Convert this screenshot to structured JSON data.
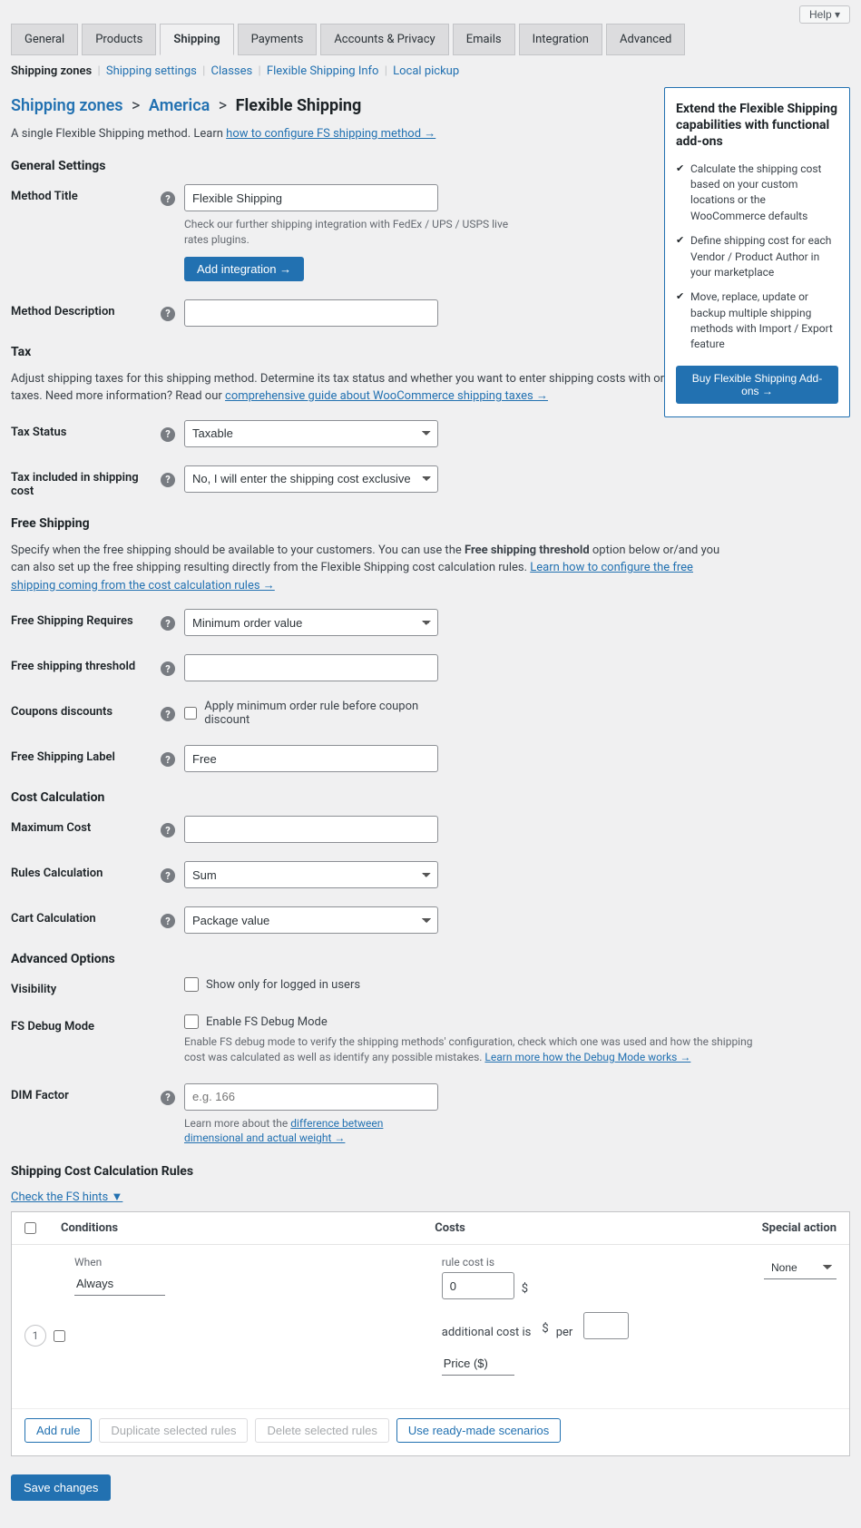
{
  "help_button": "Help ▾",
  "tabs": [
    "General",
    "Products",
    "Shipping",
    "Payments",
    "Accounts & Privacy",
    "Emails",
    "Integration",
    "Advanced"
  ],
  "active_tab": "Shipping",
  "subnav": {
    "items": [
      "Shipping zones",
      "Shipping settings",
      "Classes",
      "Flexible Shipping Info",
      "Local pickup"
    ],
    "active": "Shipping zones"
  },
  "breadcrumb": {
    "zone": "Shipping zones",
    "area": "America",
    "method": "Flexible Shipping"
  },
  "intro": {
    "text": "A single Flexible Shipping method. Learn ",
    "link": "how to configure FS shipping method →"
  },
  "sidebox": {
    "title": "Extend the Flexible Shipping capabilities with functional add-ons",
    "items": [
      "Calculate the shipping cost based on your custom locations or the WooCommerce defaults",
      "Define shipping cost for each Vendor / Product Author in your marketplace",
      "Move, replace, update or backup multiple shipping methods with Import / Export feature"
    ],
    "cta": "Buy Flexible Shipping Add-ons →"
  },
  "sections": {
    "general": "General Settings",
    "tax": "Tax",
    "free": "Free Shipping",
    "cost": "Cost Calculation",
    "adv": "Advanced Options",
    "rules": "Shipping Cost Calculation Rules"
  },
  "fields": {
    "method_title": {
      "label": "Method Title",
      "value": "Flexible Shipping",
      "hint": "Check our further shipping integration with FedEx / UPS / USPS live rates plugins.",
      "btn": "Add integration →"
    },
    "method_desc": {
      "label": "Method Description",
      "value": ""
    },
    "tax_para_a": "Adjust shipping taxes for this shipping method. Determine its tax status and whether you want to enter shipping costs with or without taxes. Need more information? Read our ",
    "tax_para_link": "comprehensive guide about WooCommerce shipping taxes →",
    "tax_status": {
      "label": "Tax Status",
      "value": "Taxable"
    },
    "tax_included": {
      "label": "Tax included in shipping cost",
      "value": "No, I will enter the shipping cost exclusive of tax"
    },
    "free_para_a": "Specify when the free shipping should be available to your customers. You can use the ",
    "free_para_bold": "Free shipping threshold",
    "free_para_b": " option below or/and you can also set up the free shipping resulting directly from the Flexible Shipping cost calculation rules. ",
    "free_para_link": "Learn how to configure the free shipping coming from the cost calculation rules →",
    "free_req": {
      "label": "Free Shipping Requires",
      "value": "Minimum order value"
    },
    "free_thresh": {
      "label": "Free shipping threshold",
      "value": ""
    },
    "coupons": {
      "label": "Coupons discounts",
      "chk": "Apply minimum order rule before coupon discount"
    },
    "free_label": {
      "label": "Free Shipping Label",
      "value": "Free"
    },
    "max_cost": {
      "label": "Maximum Cost",
      "value": ""
    },
    "rules_calc": {
      "label": "Rules Calculation",
      "value": "Sum"
    },
    "cart_calc": {
      "label": "Cart Calculation",
      "value": "Package value"
    },
    "visibility": {
      "label": "Visibility",
      "chk": "Show only for logged in users"
    },
    "debug": {
      "label": "FS Debug Mode",
      "chk": "Enable FS Debug Mode",
      "hint_a": "Enable FS debug mode to verify the shipping methods' configuration, check which one was used and how the shipping cost was calculated as well as identify any possible mistakes. ",
      "hint_link": "Learn more how the Debug Mode works →"
    },
    "dim": {
      "label": "DIM Factor",
      "placeholder": "e.g. 166",
      "hint_a": "Learn more about the ",
      "hint_link": "difference between dimensional and actual weight →"
    }
  },
  "rules": {
    "hints_link": "Check the FS hints ▼",
    "headers": {
      "cond": "Conditions",
      "costs": "Costs",
      "spec": "Special action"
    },
    "row": {
      "num": "1",
      "when_label": "When",
      "when_value": "Always",
      "rule_cost_label": "rule cost is",
      "rule_cost_value": "0",
      "currency": "$",
      "addl_label": "additional cost is",
      "per": "per",
      "price_sel": "Price ($)",
      "spec": "None"
    },
    "actions": {
      "add": "Add rule",
      "dup": "Duplicate selected rules",
      "del": "Delete selected rules",
      "scen": "Use ready-made scenarios"
    }
  },
  "save": "Save changes"
}
